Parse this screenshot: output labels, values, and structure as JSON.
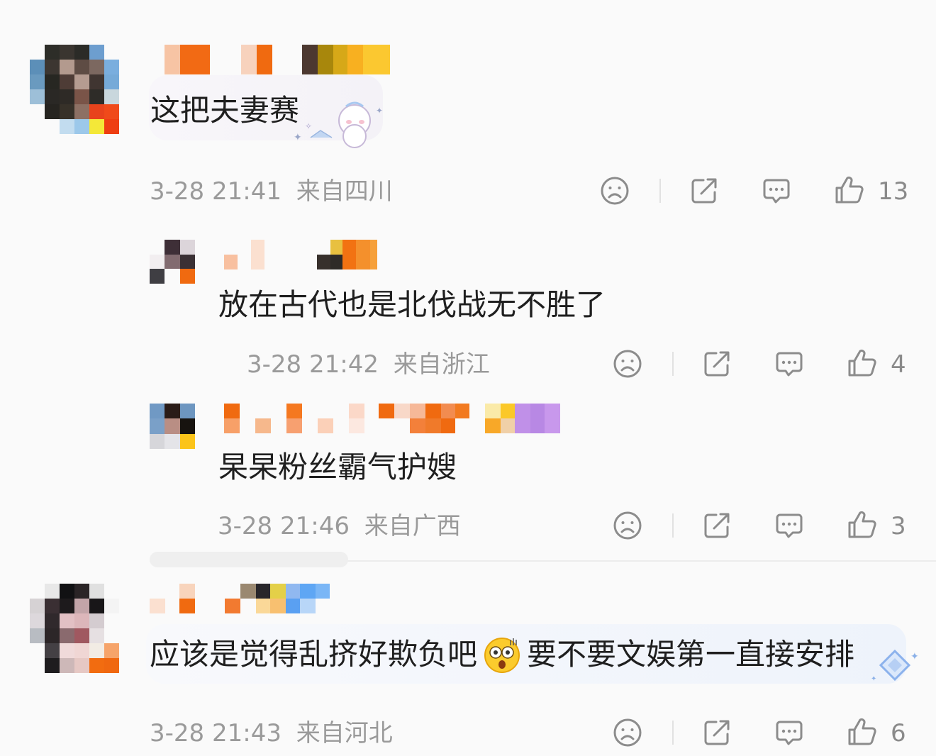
{
  "comments": [
    {
      "text": "这把夫妻赛",
      "time": "3-28 21:41",
      "location": "来自四川",
      "likes": "13"
    },
    {
      "text": "放在古代也是北伐战无不胜了",
      "time": "3-28 21:42",
      "location": "来自浙江",
      "likes": "4"
    },
    {
      "text": "杲杲粉丝霸气护嫂",
      "time": "3-28 21:46",
      "location": "来自广西",
      "likes": "3"
    },
    {
      "text_part1": "应该是觉得乱挤好欺负吧",
      "text_part2": "要不要文娱第一直接安排",
      "time": "3-28 21:43",
      "location": "来自河北",
      "likes": "6"
    }
  ],
  "icons": [
    "dislike-icon",
    "share-icon",
    "reply-icon",
    "like-icon",
    "shock-emoji-icon",
    "diamond-badge-icon"
  ],
  "colors": {
    "text": "#1f1f1f",
    "meta": "#9a9a9a",
    "icon": "#8c8c8c",
    "background": "#fafafa"
  }
}
